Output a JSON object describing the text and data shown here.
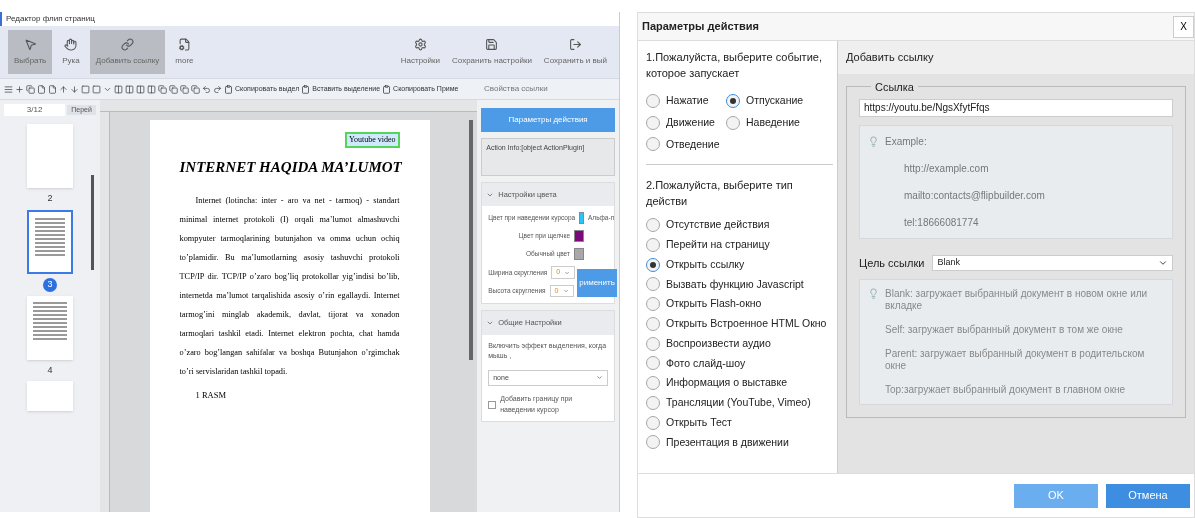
{
  "editor": {
    "title": "Редактор флип страниц",
    "tools": [
      {
        "label": "Выбрать",
        "selected": true
      },
      {
        "label": "Рука",
        "selected": false
      },
      {
        "label": "Добавить ссылку",
        "selected": true
      },
      {
        "label": "more",
        "selected": false
      }
    ],
    "tools_right": [
      "Настройки",
      "Сохранить настройки",
      "Сохранить и вый"
    ],
    "edit_actions": [
      "Скопировать выдел",
      "Вставить выделение",
      "Скопировать Приме"
    ],
    "properties_title": "Свойства ссылки",
    "page_field": "3/12",
    "goto_button": "Перей",
    "thumbnails": [
      {
        "label": "2",
        "selected": false,
        "kind": "blank"
      },
      {
        "label": "3",
        "selected": true,
        "kind": "text"
      },
      {
        "label": "4",
        "selected": false,
        "kind": "text"
      }
    ],
    "document": {
      "link_label": "Youtube video",
      "heading": "INTERNET HAQIDA MA’LUMOT",
      "paragraph": "Internet (lotincha: inter - aro va net - tarmoq) - standart minimal internet protokoli (I) orqali ma’lumot almashuvchi kompyuter tarmoqlarining butunjahon va omma uchun ochiq to’plamidir. Bu ma’lumotlarning asosiy tashuvchi protokoli TCP/IP dir. TCP/IP o’zaro bog’liq protokollar yig’indisi bo’lib, internetda ma’lumot tarqalishida asosiy o’rin egallaydi. Internet tarmog’ini minglab akademik, davlat, tijorat va xonadon tarmoqlari tashkil etadi. Internet elektron pochta, chat hamda o’zaro bog’langan sahifalar va boshqa Butunjahon o’rgimchak to’ri servislaridan tashkil topadi.",
      "caption": "1 RASM"
    },
    "properties": {
      "action_button": "Параметры действия",
      "action_info": "Action Info:[object ActionPlugin]",
      "color_section": "Настройки цвета",
      "colors": [
        {
          "label": "Цвет при наведении курсора",
          "color": "#29c5f6",
          "extra": "Альфа-п"
        },
        {
          "label": "Цвет при щелчке",
          "color": "#7a0a7a"
        },
        {
          "label": "Обычный цвет",
          "color": "#a8a8a8"
        }
      ],
      "rounding": [
        {
          "label": "Ширина скругления",
          "value": "0"
        },
        {
          "label": "Высота скругления",
          "value": "0"
        }
      ],
      "apply_button": "рименить",
      "general_section": "Общие Настройки",
      "highlight_label": "Включить эффект выделения, когда мышь ,",
      "highlight_value": "none",
      "border_checkbox": {
        "label": "Добавить границу при наведении курсор",
        "checked": false
      }
    }
  },
  "dialog": {
    "title": "Параметры действия",
    "close": "X",
    "step1": "1.Пожалуйста, выберите событие, которое запускает",
    "events": [
      {
        "label": "Нажатие",
        "selected": false
      },
      {
        "label": "Отпускание",
        "selected": true
      },
      {
        "label": "Движение",
        "selected": false
      },
      {
        "label": "Наведение",
        "selected": false
      },
      {
        "label": "Отведение",
        "selected": false
      }
    ],
    "step2": "2.Пожалуйста, выберите тип действи",
    "actions": [
      {
        "label": "Отсутствие действия",
        "selected": false
      },
      {
        "label": "Перейти на страницу",
        "selected": false
      },
      {
        "label": "Открыть ссылку",
        "selected": true
      },
      {
        "label": "Вызвать функцию Javascript",
        "selected": false
      },
      {
        "label": "Открыть Flash-окно",
        "selected": false
      },
      {
        "label": "Открыть Встроенное HTML Окно",
        "selected": false
      },
      {
        "label": "Воспроизвести аудио",
        "selected": false
      },
      {
        "label": "Фото слайд-шоу",
        "selected": false
      },
      {
        "label": "Информация о выставке",
        "selected": false
      },
      {
        "label": "Трансляции (YouTube, Vimeo)",
        "selected": false
      },
      {
        "label": "Открыть Тест",
        "selected": false
      },
      {
        "label": "Презентация в движении",
        "selected": false
      }
    ],
    "panel_title": "Добавить ссылку",
    "fieldset": "Ссылка",
    "url": "https://youtu.be/NgsXfytFfqs",
    "example_title": "Example:",
    "examples": [
      "http://example.com",
      "mailto:contacts@flipbuilder.com",
      "tel:18666081774"
    ],
    "target_label": "Цель ссылки",
    "target_value": "Blank",
    "target_help": [
      "Blank: загружает выбранный документ в новом окне или вкладке",
      "Self: загружает выбранный документ в том же окне",
      "Parent: загружает выбранный документ в родительском окне",
      "Top:загружает выбранный документ в главном окне"
    ],
    "ok": "OK",
    "cancel": "Отмена"
  }
}
